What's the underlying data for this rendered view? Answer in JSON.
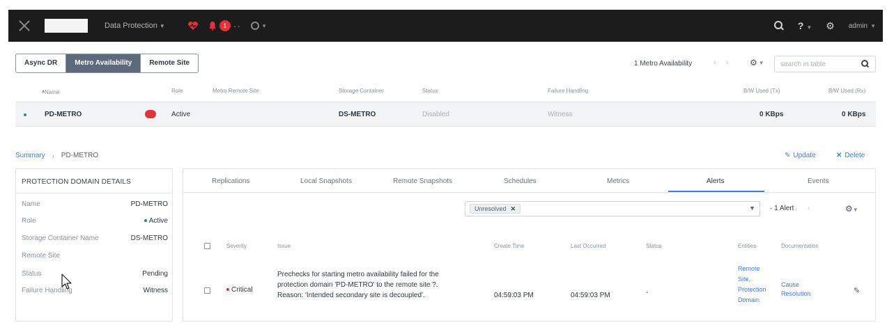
{
  "topbar": {
    "menu_label": "Data Protection",
    "alert_count": "1",
    "user": "admin",
    "help_label": "?"
  },
  "tabs": [
    {
      "label": "Async DR",
      "active": false
    },
    {
      "label": "Metro Availability",
      "active": true
    },
    {
      "label": "Remote Site",
      "active": false
    }
  ],
  "toolbar": {
    "count_label": "1 Metro Availability",
    "search_placeholder": "search in table"
  },
  "table": {
    "columns": [
      "Name",
      "Role",
      "Metro Remote Site",
      "Storage Container",
      "Status",
      "Failure Handling",
      "B/W Used (Tx)",
      "B/W Used (Rx)"
    ],
    "rows": [
      {
        "name": "PD-METRO",
        "role": "Active",
        "remote_site": "",
        "storage_container": "DS-METRO",
        "status": "Disabled",
        "failure_handling": "Witness",
        "bw_tx": "0 KBps",
        "bw_rx": "0 KBps"
      }
    ]
  },
  "breadcrumb": {
    "root": "Summary",
    "current": "PD-METRO"
  },
  "actions": {
    "update": "Update",
    "delete": "Delete"
  },
  "details": {
    "title": "PROTECTION DOMAIN DETAILS",
    "rows": [
      {
        "key": "Name",
        "value": "PD-METRO"
      },
      {
        "key": "Role",
        "value": "Active"
      },
      {
        "key": "Storage Container Name",
        "value": "DS-METRO"
      },
      {
        "key": "Remote Site",
        "value": ""
      },
      {
        "key": "Status",
        "value": "Pending"
      },
      {
        "key": "Failure Handling",
        "value": "Witness"
      }
    ]
  },
  "subtabs": [
    "Replications",
    "Local Snapshots",
    "Remote Snapshots",
    "Schedules",
    "Metrics",
    "Alerts",
    "Events"
  ],
  "alerts": {
    "filter_chip": "Unresolved",
    "count_label": "1 Alert",
    "columns": [
      "Severity",
      "Issue",
      "Create Time",
      "Last Occurred",
      "Status",
      "Entities",
      "Documentation"
    ],
    "rows": [
      {
        "severity": "Critical",
        "issue": "Prechecks for starting metro availability failed for the protection domain 'PD-METRO' to the remote site ?. Reason: 'Intended secondary site is decoupled'.",
        "create_time": "04:59:03 PM",
        "last_occurred": "04:59:03 PM",
        "status": "-",
        "entities": "Remote Site, Protection Domain",
        "documentation": "Cause Resolution"
      }
    ]
  },
  "colors": {
    "topbar": "#1c1c1c",
    "active_tab": "#5b6a7c",
    "link": "#3f7fd6",
    "critical": "#e0333a",
    "ok": "#2f8f5b"
  }
}
